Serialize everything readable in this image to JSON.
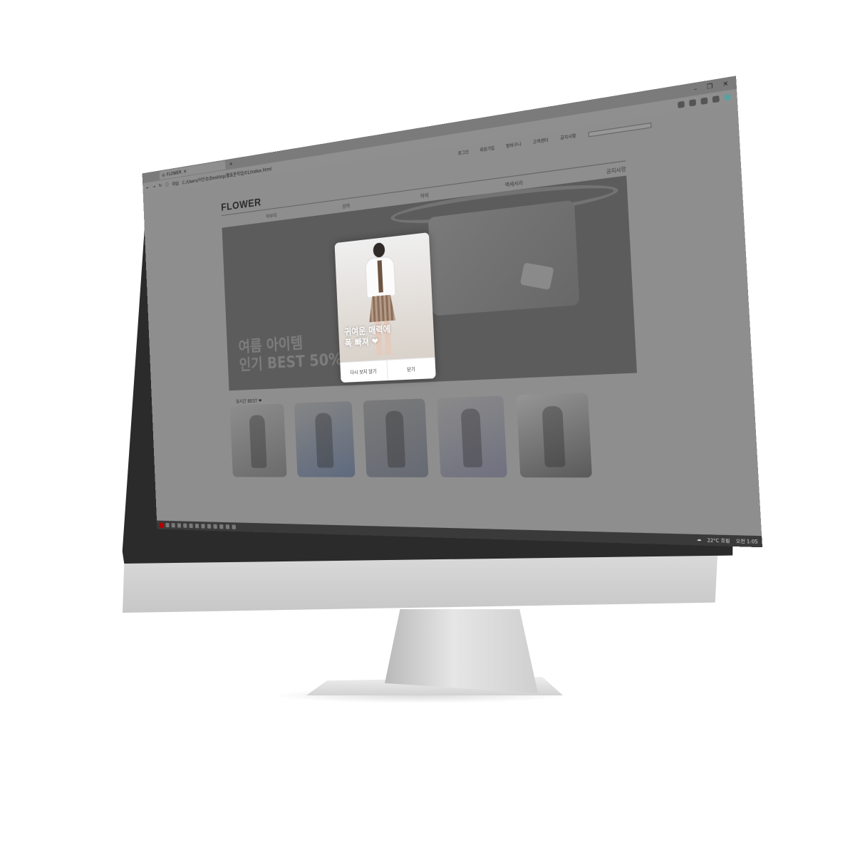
{
  "browser": {
    "tab_title": "FLOWER",
    "tab_close": "×",
    "new_tab": "+",
    "address": "C:/Users/이은송/Desktop/웹표준작업/01/index.html",
    "address_prefix": "파일"
  },
  "site": {
    "logo": "FLOWER",
    "utility_links": [
      "로그인",
      "회원가입",
      "장바구니",
      "고객센터",
      "공지사항"
    ],
    "nav": [
      "아우터",
      "상의",
      "하의",
      "액세서리",
      "공지사항"
    ],
    "hero_line1": "여름 아이템",
    "hero_line2": "인기 BEST 50%",
    "best_title": "실시간 BEST ❤"
  },
  "popup": {
    "line1": "귀여운 매력에",
    "line2": "폭 빠져 ❤",
    "dont_show": "다시 보지 않기",
    "close": "닫기"
  },
  "taskbar": {
    "weather": "22°C 흐림",
    "time": "오전 1:05"
  }
}
